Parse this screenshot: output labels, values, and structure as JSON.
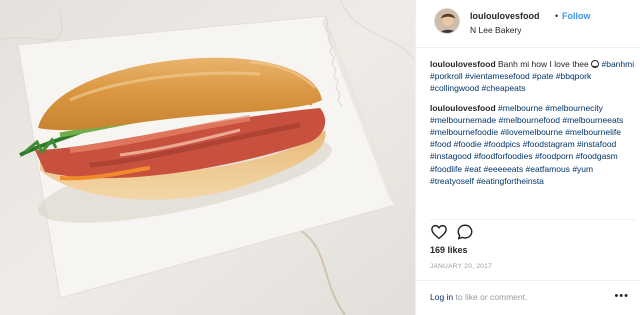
{
  "header": {
    "username": "louloulovesfood",
    "separator": "•",
    "follow_label": "Follow",
    "location": "N Lee Bakery"
  },
  "caption": {
    "username": "louloulovesfood",
    "text": "Banh mi how I love thee",
    "emoji_icon": "smiley-icon",
    "hashtags": [
      "#banhmi",
      "#porkroll",
      "#vientamesefood",
      "#pate",
      "#bbqpork",
      "#collingwood",
      "#cheapeats"
    ]
  },
  "comment": {
    "username": "louloulovesfood",
    "hashtags": [
      "#melbourne",
      "#melbournecity",
      "#melbournemade",
      "#melbournefood",
      "#melbourneeats",
      "#melbournefoodie",
      "#ilovemelbourne",
      "#melbournelife",
      "#food",
      "#foodie",
      "#foodpics",
      "#foodstagram",
      "#instafood",
      "#instagood",
      "#foodforfoodies",
      "#foodporn",
      "#foodgasm",
      "#foodlife",
      "#eat",
      "#eeeeeats",
      "#eatfamous",
      "#yum",
      "#treatyoself",
      "#eatingfortheinsta"
    ]
  },
  "actions": {
    "like_icon": "heart-outline-icon",
    "comment_icon": "comment-bubble-icon"
  },
  "likes": "169 likes",
  "date": "JANUARY 20, 2017",
  "footer": {
    "login_link": "Log in",
    "login_rest": " to like or comment.",
    "more_label": "•••"
  },
  "photo": {
    "subject_icon": "banh-mi-photo",
    "colors": {
      "marble": "#ece9e4",
      "paper": "#f8f6f3",
      "bread": "#e0a45a",
      "pork": "#c8503f"
    }
  }
}
